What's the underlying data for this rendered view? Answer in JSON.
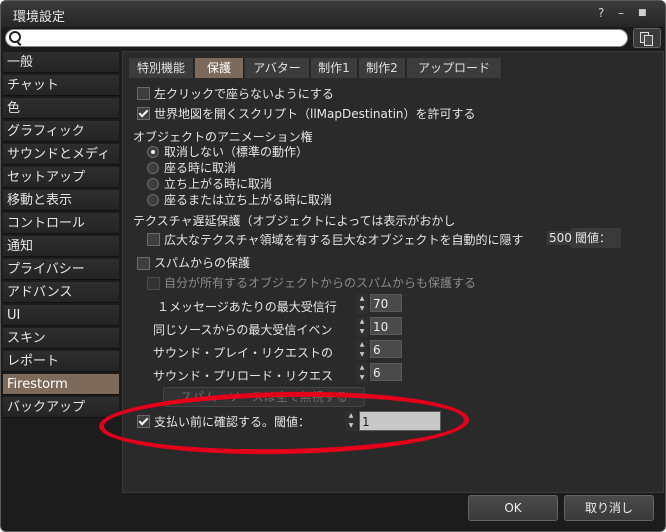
{
  "window": {
    "title": "環境設定",
    "help": "?",
    "minimize": "–",
    "close": "■"
  },
  "search": {
    "value": "",
    "placeholder": ""
  },
  "sidebar": {
    "items": [
      {
        "label": "一般"
      },
      {
        "label": "チャット"
      },
      {
        "label": "色"
      },
      {
        "label": "グラフィック"
      },
      {
        "label": "サウンドとメディ"
      },
      {
        "label": "セットアップ"
      },
      {
        "label": "移動と表示"
      },
      {
        "label": "コントロール"
      },
      {
        "label": "通知"
      },
      {
        "label": "プライバシー"
      },
      {
        "label": "アドバンス"
      },
      {
        "label": "UI"
      },
      {
        "label": "スキン"
      },
      {
        "label": "レポート"
      },
      {
        "label": "Firestorm"
      },
      {
        "label": "バックアップ"
      }
    ],
    "selected": "Firestorm"
  },
  "tabs": [
    {
      "label": "特別機能"
    },
    {
      "label": "保護"
    },
    {
      "label": "アバター"
    },
    {
      "label": "制作1"
    },
    {
      "label": "制作2"
    },
    {
      "label": "アップロード"
    }
  ],
  "selected_tab": "保護",
  "settings": {
    "no_left_click_sit": {
      "label": "左クリックで座らないようにする",
      "checked": false
    },
    "allow_map_script": {
      "label": "世界地図を開くスクリプト（llMapDestinatin）を許可する",
      "checked": true
    },
    "anim_heading": "オブジェクトのアニメーション権",
    "anim_options": [
      {
        "label": "取消しない（標準の動作）",
        "selected": true
      },
      {
        "label": "座る時に取消",
        "selected": false
      },
      {
        "label": "立ち上がる時に取消",
        "selected": false
      },
      {
        "label": "座るまたは立ち上がる時に取消",
        "selected": false
      }
    ],
    "texture_heading": "テクスチャ遅延保護（オブジェクトによっては表示がおかし",
    "texture_auto": {
      "label": "広大なテクスチャ領域を有する巨大なオブジェクトを自動的に隠す",
      "checked": false
    },
    "threshold_label": "閾値：",
    "threshold_value": "500",
    "spam": {
      "label": "スパムからの保護",
      "checked": false
    },
    "spam_owned": {
      "label": "自分が所有するオブジェクトからのスパムからも保護する",
      "checked": false
    },
    "spam_fields": [
      {
        "label": "１メッセージあたりの最大受信行",
        "value": "70"
      },
      {
        "label": "同じソースからの最大受信イベン",
        "value": "10"
      },
      {
        "label": "サウンド・プレイ・リクエストの",
        "value": "6"
      },
      {
        "label": "サウンド・プリロード・リクエス",
        "value": "6"
      }
    ],
    "unblock_button": "スパム・ソースは全て無視する",
    "confirm_pay": {
      "label": "支払い前に確認する。閾値：",
      "checked": true,
      "value": "1"
    }
  },
  "footer": {
    "ok": "OK",
    "cancel": "取り消し"
  },
  "colors": {
    "accent": "#7d6a5a",
    "highlight_oval": "#e4001b"
  }
}
